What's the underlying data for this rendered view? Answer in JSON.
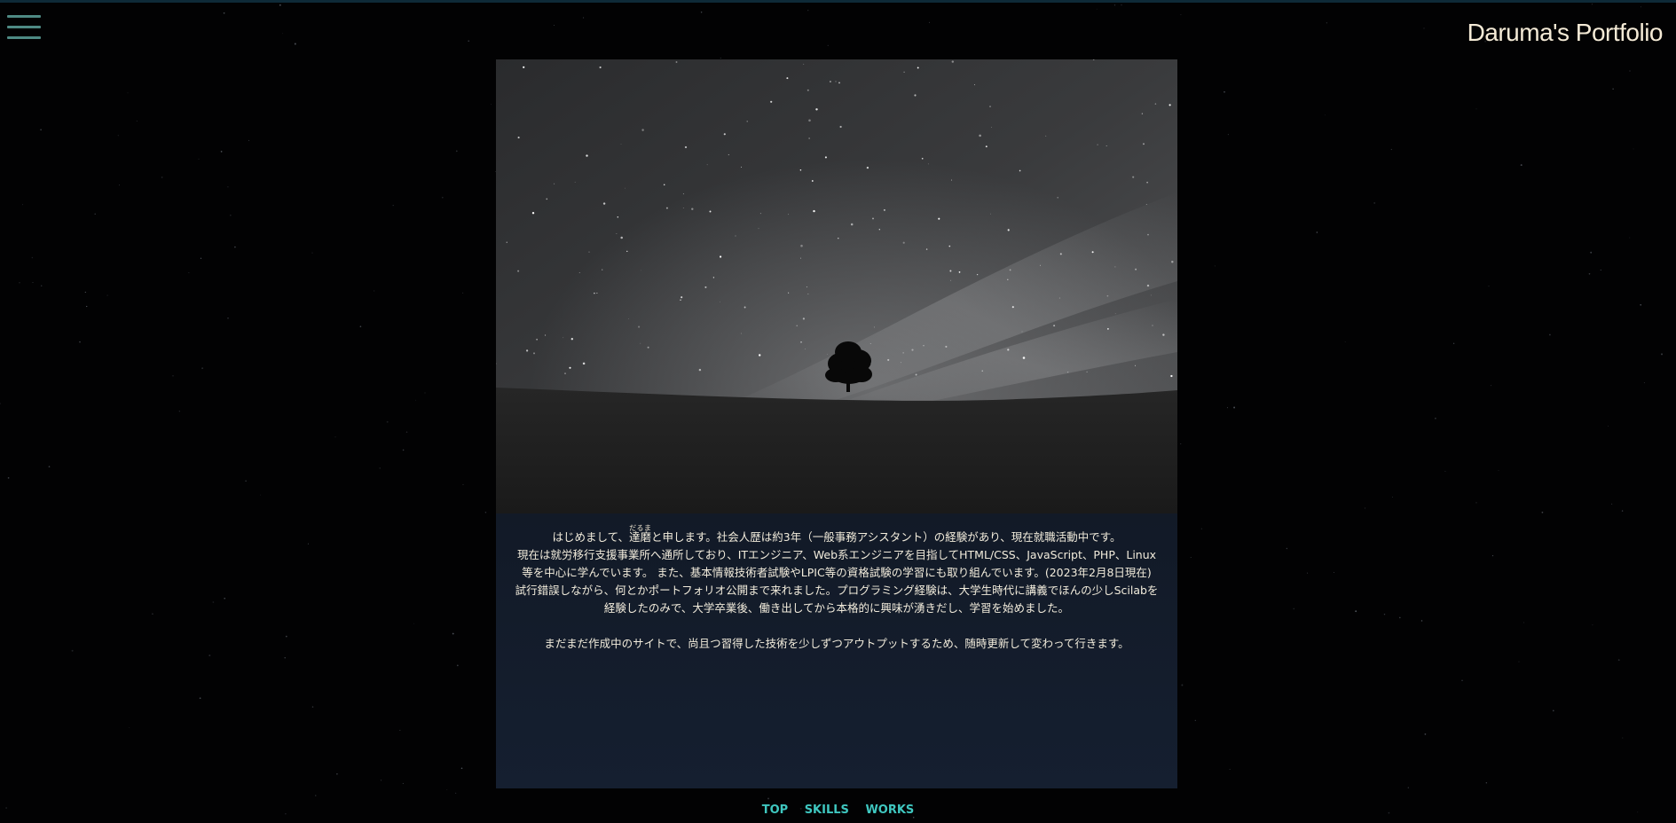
{
  "header": {
    "menu_icon": "hamburger-menu-icon",
    "title": "Daruma's Portfolio"
  },
  "hero": {
    "image": "night-sky-lone-tree-photo"
  },
  "intro": {
    "line1_a": "はじめまして、",
    "name": "達磨",
    "name_reading": "だるま",
    "line1_b": "と申します。社会人歴は約3年（一般事務アシスタント）の経験があり、現在就職活動中です。",
    "line2": "現在は就労移行支援事業所へ通所しており、ITエンジニア、Web系エンジニアを目指してHTML/CSS、JavaScript、PHP、Linux",
    "line3": "等を中心に学んでいます。 また、基本情報技術者試験やLPIC等の資格試験の学習にも取り組んでいます。(2023年2月8日現在)",
    "line4": "試行錯誤しながら、何とかポートフォリオ公開まで来れました。プログラミング経験は、大学生時代に講義でほんの少しScilabを",
    "line5": "経験したのみで、大学卒業後、働き出してから本格的に興味が湧きだし、学習を始めました。",
    "line6": "まだまだ作成中のサイトで、尚且つ習得した技術を少しずつアウトプットするため、随時更新して変わって行きます。"
  },
  "footer_nav": {
    "items": [
      "TOP",
      "SKILLS",
      "WORKS"
    ]
  },
  "colors": {
    "background": "#020203",
    "title": "#f4ead6",
    "menu_icon": "#4e8a84",
    "nav_link": "#3fc7c0",
    "body_text": "#f2ecdc"
  }
}
